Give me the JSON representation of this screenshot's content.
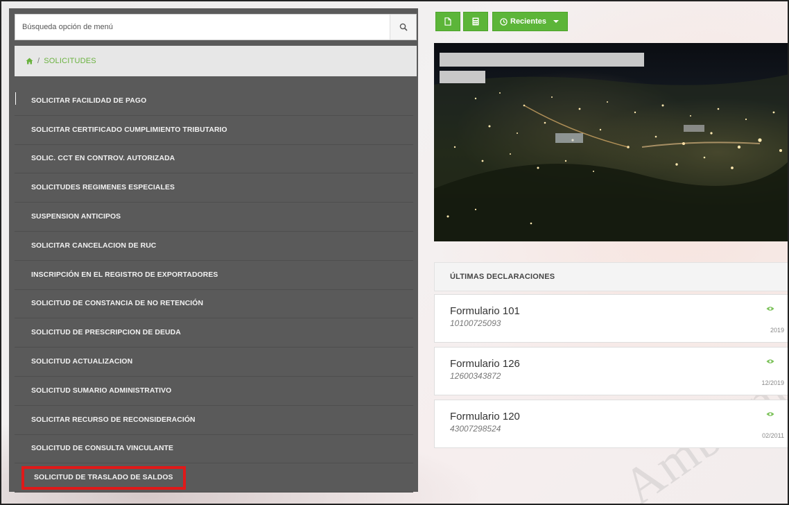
{
  "search": {
    "placeholder": "Búsqueda opción de menú",
    "icon": "search-icon"
  },
  "breadcrumb": {
    "home_icon": "home-icon",
    "separator": "/",
    "current": "SOLICITUDES"
  },
  "menu": {
    "items": [
      {
        "label": "SOLICITAR FACILIDAD DE PAGO"
      },
      {
        "label": "SOLICITAR CERTIFICADO CUMPLIMIENTO TRIBUTARIO"
      },
      {
        "label": "SOLIC. CCT EN CONTROV. AUTORIZADA"
      },
      {
        "label": "SOLICITUDES REGIMENES ESPECIALES"
      },
      {
        "label": "SUSPENSION ANTICIPOS"
      },
      {
        "label": "SOLICITAR CANCELACION DE RUC"
      },
      {
        "label": "INSCRIPCIÓN EN EL REGISTRO DE EXPORTADORES"
      },
      {
        "label": "SOLICITUD DE CONSTANCIA DE NO RETENCIÓN"
      },
      {
        "label": "SOLICITUD DE PRESCRIPCION DE DEUDA"
      },
      {
        "label": "SOLICITUD ACTUALIZACION"
      },
      {
        "label": "SOLICITUD SUMARIO ADMINISTRATIVO"
      },
      {
        "label": "SOLICITAR RECURSO DE RECONSIDERACIÓN"
      },
      {
        "label": "SOLICITUD DE CONSULTA VINCULANTE"
      },
      {
        "label": "SOLICITUD DE TRASLADO DE SALDOS",
        "highlighted": true
      }
    ]
  },
  "toolbar": {
    "recent_label": "Recientes",
    "icons": [
      "document-icon",
      "calculator-icon",
      "clock-icon"
    ]
  },
  "declarations": {
    "title": "ÚLTIMAS DECLARACIONES",
    "items": [
      {
        "form": "Formulario 101",
        "number": "10100725093",
        "period": "2019"
      },
      {
        "form": "Formulario 126",
        "number": "12600343872",
        "period": "12/2019"
      },
      {
        "form": "Formulario 120",
        "number": "43007298524",
        "period": "02/2011"
      }
    ]
  },
  "watermark": "Ambiente",
  "colors": {
    "accent_green": "#5cb539",
    "panel_gray": "#5a5a5a",
    "highlight_red": "#e01919"
  }
}
